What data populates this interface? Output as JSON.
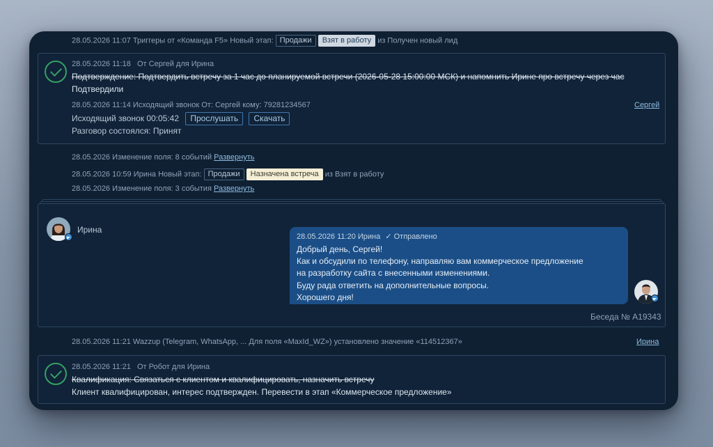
{
  "row1": {
    "datetime": "28.05.2026 11:07",
    "text": "Триггеры от «Команда F5» Новый этап:",
    "pipeline": "Продажи",
    "stage": "Взят в работу",
    "from_text": "из Получен новый лид"
  },
  "task1": {
    "datetime": "28.05.2026 11:18",
    "author": "От Сергей для Ирина",
    "title": "Подтверждение: Подтвердить встречу за 1 час до планируемой встречи (2026-05-28 15:00:00 МСК) и напомнить Ирине про встречу через час",
    "result": "Подтвердили"
  },
  "call": {
    "meta": "28.05.2026 11:14 Исходящий звонок От: Сергей кому: 79281234567",
    "owner_link": "Сергей",
    "duration_label": "Исходящий звонок 00:05:42",
    "listen_button": "Прослушать",
    "download_button": "Скачать",
    "status": "Разговор состоялся: Принят"
  },
  "field_change1": {
    "text": "28.05.2026 Изменение поля: 8 событий",
    "link": "Развернуть"
  },
  "stage_change": {
    "text": "28.05.2026 10:59 Ирина Новый этап:",
    "pipeline": "Продажи",
    "stage": "Назначена встреча",
    "from_text": "из Взят в работу"
  },
  "field_change2": {
    "text": "28.05.2026 Изменение поля: 3 события",
    "link": "Развернуть"
  },
  "chat": {
    "contact_name": "Ирина",
    "message_meta": "28.05.2026 11:20 Ирина",
    "message_status": "Отправлено",
    "lines": [
      "Добрый день, Сергей!",
      "Как и обсудили по телефону, направляю вам коммерческое предложение",
      "на разработку сайта с внесенными изменениями.",
      "Буду рада ответить на дополнительные вопросы.",
      "Хорошего дня!"
    ],
    "conversation_label": "Беседа № A19343"
  },
  "wazzup": {
    "text": "28.05.2026 11:21 Wazzup (Telegram, WhatsApp, ... Для поля «MaxId_WZ») установлено значение «114512367»",
    "owner_link": "Ирина"
  },
  "task2": {
    "datetime": "28.05.2026 11:21",
    "author": "От Робот для Ирина",
    "title": "Квалификация: Связаться с клиентом и квалифицировать, назначить встречу",
    "result": "Клиент квалифицирован, интерес подтвержден. Перевести в этап «Коммерческое предложение»"
  },
  "colors": {
    "panel": "#0f2033",
    "accent_blue": "#1b4e86",
    "check_green": "#36a065",
    "link": "#8fbce0"
  }
}
